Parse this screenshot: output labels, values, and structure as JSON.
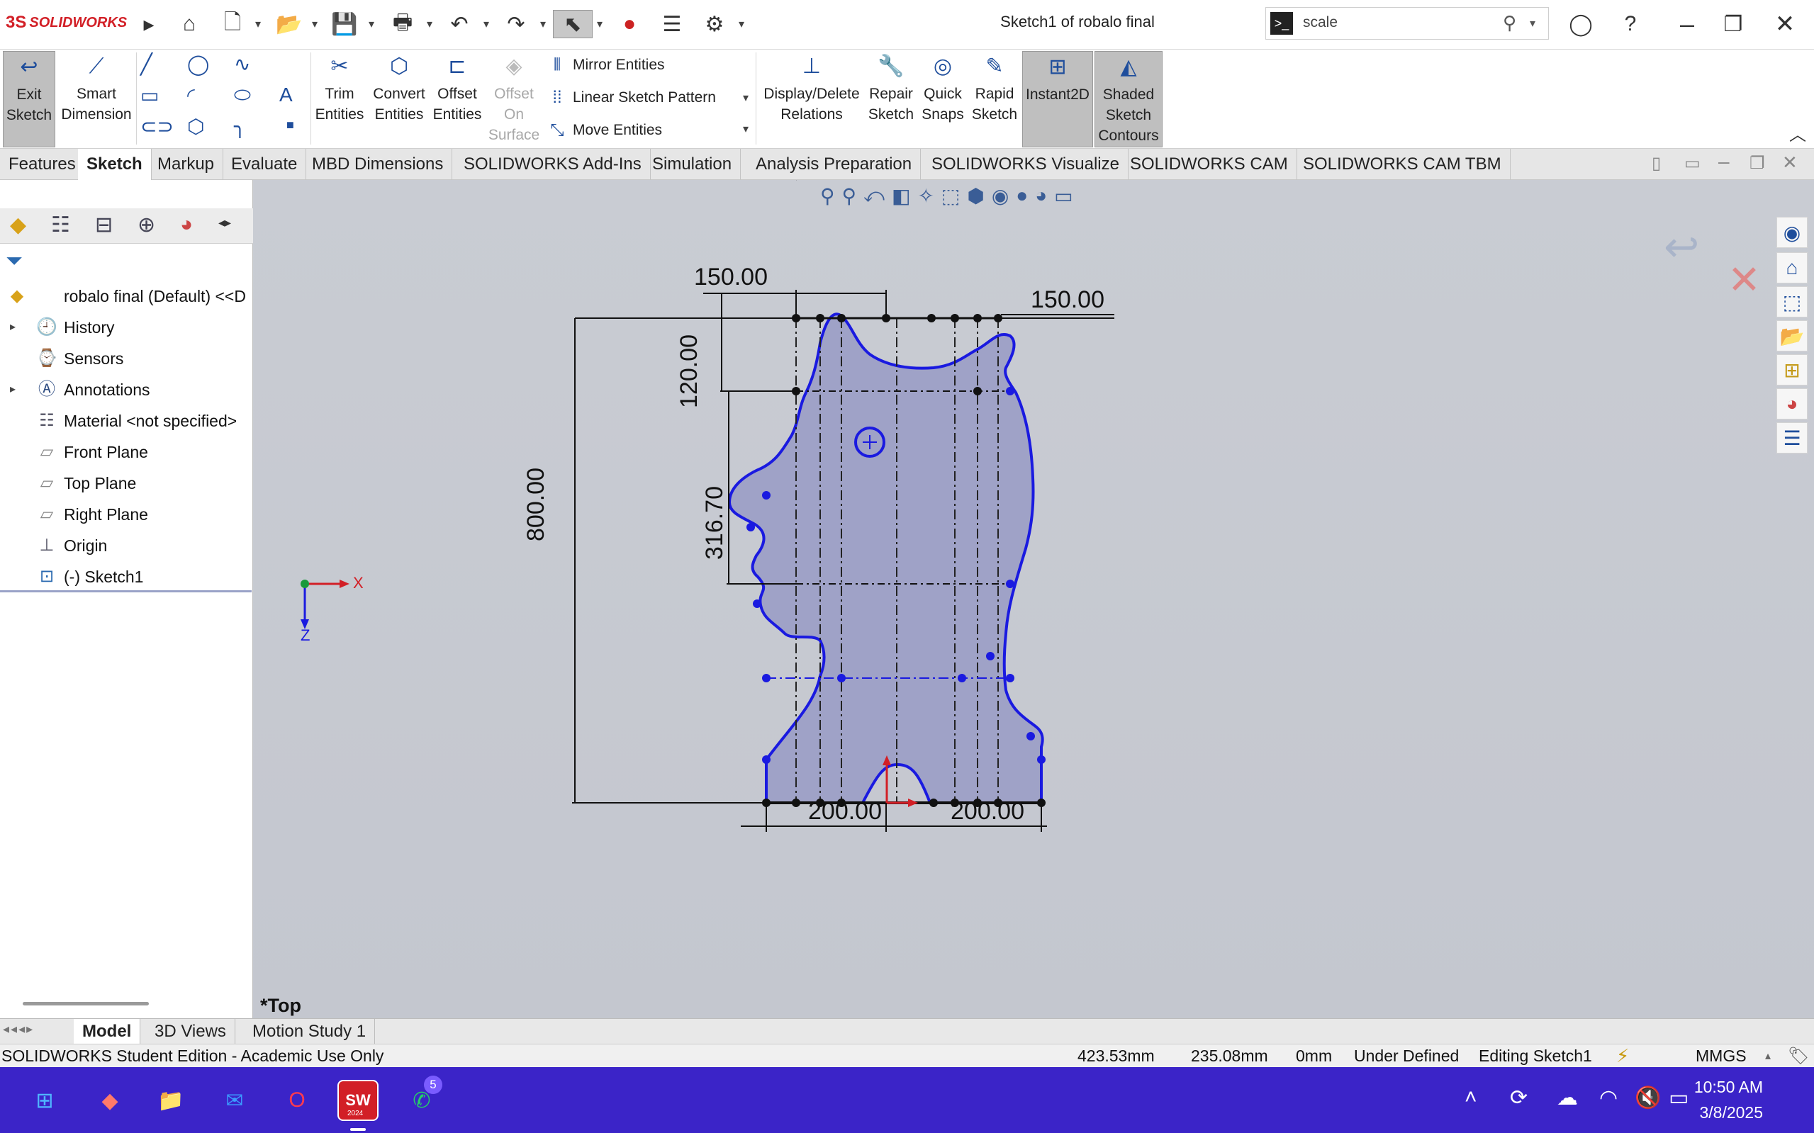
{
  "app": {
    "logo_text": "SOLIDWORKS",
    "doc_title": "Sketch1 of robalo final"
  },
  "search": {
    "value": "scale"
  },
  "ribbon": {
    "exit_sketch": "Exit Sketch",
    "smart_dimension": "Smart Dimension",
    "trim_entities": "Trim Entities",
    "convert_entities": "Convert Entities",
    "offset_entities": "Offset Entities",
    "offset_on_surface": "Offset On Surface",
    "mirror_entities": "Mirror Entities",
    "linear_sketch_pattern": "Linear Sketch Pattern",
    "move_entities": "Move Entities",
    "display_delete_relations": "Display/Delete Relations",
    "repair_sketch": "Repair Sketch",
    "quick_snaps": "Quick Snaps",
    "rapid_sketch": "Rapid Sketch",
    "instant2d": "Instant2D",
    "shaded_sketch_contours": "Shaded Sketch Contours"
  },
  "tabs": [
    "Features",
    "Sketch",
    "Markup",
    "Evaluate",
    "MBD Dimensions",
    "SOLIDWORKS Add-Ins",
    "Simulation",
    "Analysis Preparation",
    "SOLIDWORKS Visualize",
    "SOLIDWORKS CAM",
    "SOLIDWORKS CAM TBM"
  ],
  "tree": {
    "root": "robalo final (Default) <<D",
    "items": [
      "History",
      "Sensors",
      "Annotations",
      "Material <not specified>",
      "Front Plane",
      "Top Plane",
      "Right Plane",
      "Origin",
      "(-) Sketch1"
    ]
  },
  "dimensions": {
    "top_left_width": "150.00",
    "top_right_width": "150.00",
    "height_total": "800.00",
    "height_top": "120.00",
    "height_mid": "316.70",
    "bottom_left_width": "200.00",
    "bottom_right_width": "200.00"
  },
  "triad": {
    "x": "X",
    "z": "Z"
  },
  "view_label": "*Top",
  "bottom_tabs": [
    "Model",
    "3D Views",
    "Motion Study 1"
  ],
  "status": {
    "edition": "SOLIDWORKS Student Edition - Academic Use Only",
    "x": "423.53mm",
    "y": "235.08mm",
    "z": "0mm",
    "state": "Under Defined",
    "editing": "Editing Sketch1",
    "units": "MMGS"
  },
  "taskbar": {
    "whatsapp_badge": "5",
    "sw_badge": "2024",
    "time": "10:50 AM",
    "date": "3/8/2025"
  }
}
